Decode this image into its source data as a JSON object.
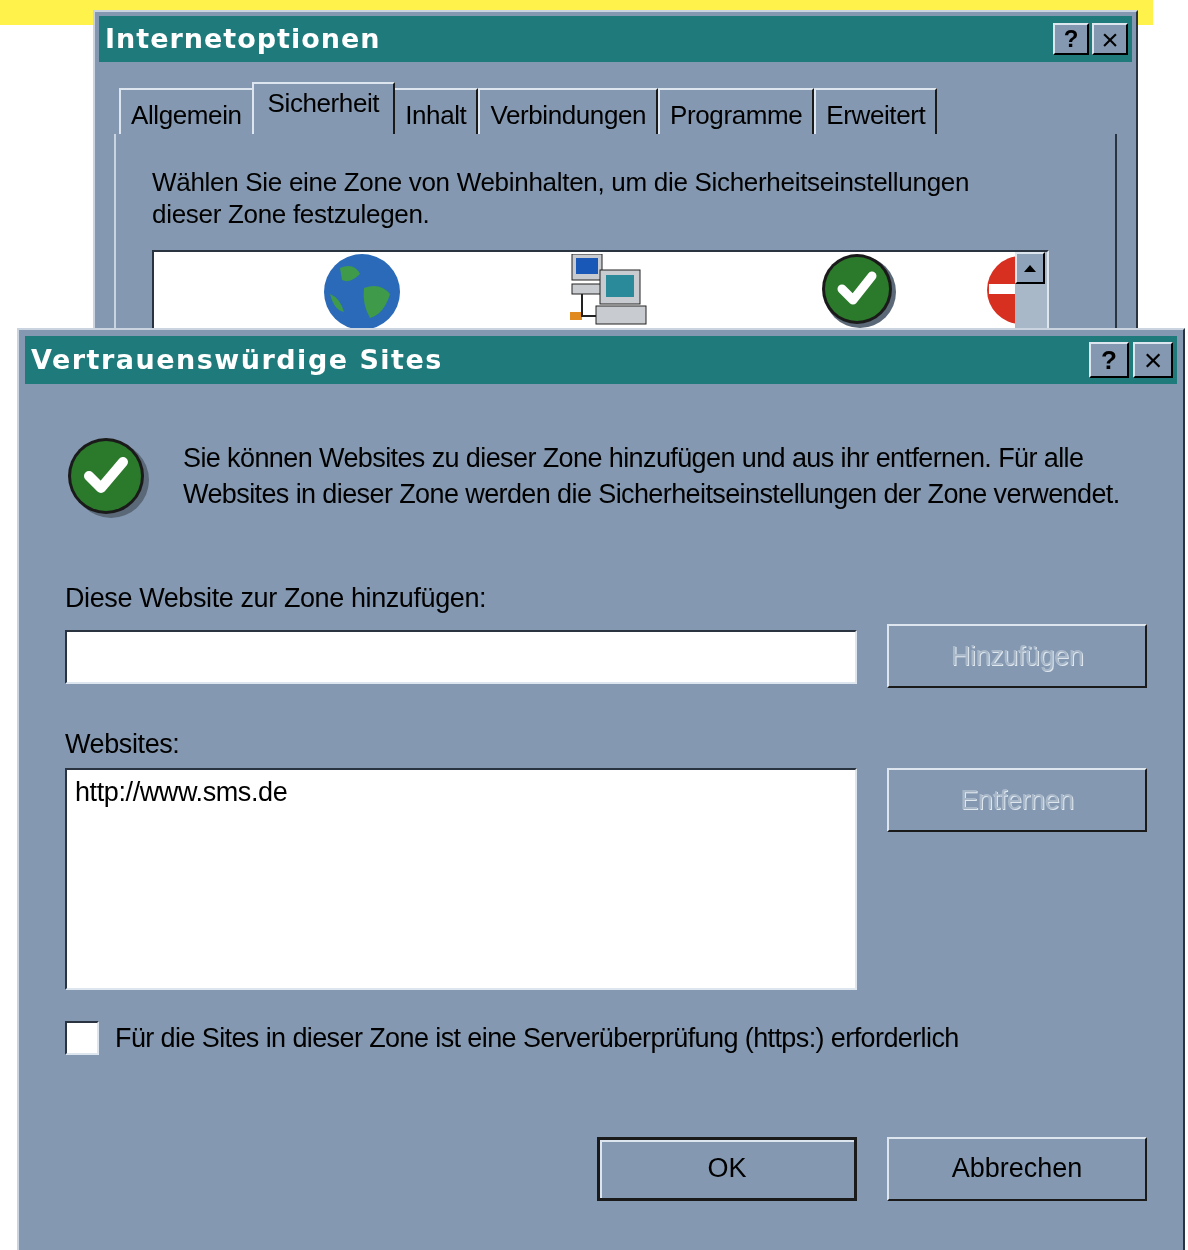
{
  "internet_options": {
    "title": "Internetoptionen",
    "help_button": "?",
    "close_button": "×",
    "tabs": [
      {
        "label": "Allgemein",
        "selected": false
      },
      {
        "label": "Sicherheit",
        "selected": true
      },
      {
        "label": "Inhalt",
        "selected": false
      },
      {
        "label": "Verbindungen",
        "selected": false
      },
      {
        "label": "Programme",
        "selected": false
      },
      {
        "label": "Erweitert",
        "selected": false
      }
    ],
    "instruction": "Wählen Sie eine Zone von Webinhalten, um die Sicherheitseinstellungen dieser Zone festzulegen.",
    "zones": [
      {
        "kind": "internet"
      },
      {
        "kind": "intranet"
      },
      {
        "kind": "trusted"
      },
      {
        "kind": "restricted"
      }
    ]
  },
  "trusted_sites": {
    "title": "Vertrauenswürdige Sites",
    "help_button": "?",
    "close_button": "×",
    "description": "Sie können Websites zu dieser Zone hinzufügen und aus ihr entfernen. Für alle Websites in dieser Zone werden die Sicherheitseinstellungen der Zone verwendet.",
    "add_label": "Diese Website zur Zone hinzufügen:",
    "add_button": {
      "label": "Hinzufügen",
      "disabled": true
    },
    "websites_label": "Websites:",
    "websites": [
      "http://www.sms.de"
    ],
    "remove_button": {
      "label": "Entfernen",
      "disabled": true
    },
    "https_checkbox": {
      "label": "Für die Sites in dieser Zone ist eine Serverüberprüfung (https:) erforderlich",
      "checked": false
    },
    "buttons": [
      {
        "label": "OK",
        "default": true
      },
      {
        "label": "Abbrechen",
        "default": false
      }
    ]
  }
}
